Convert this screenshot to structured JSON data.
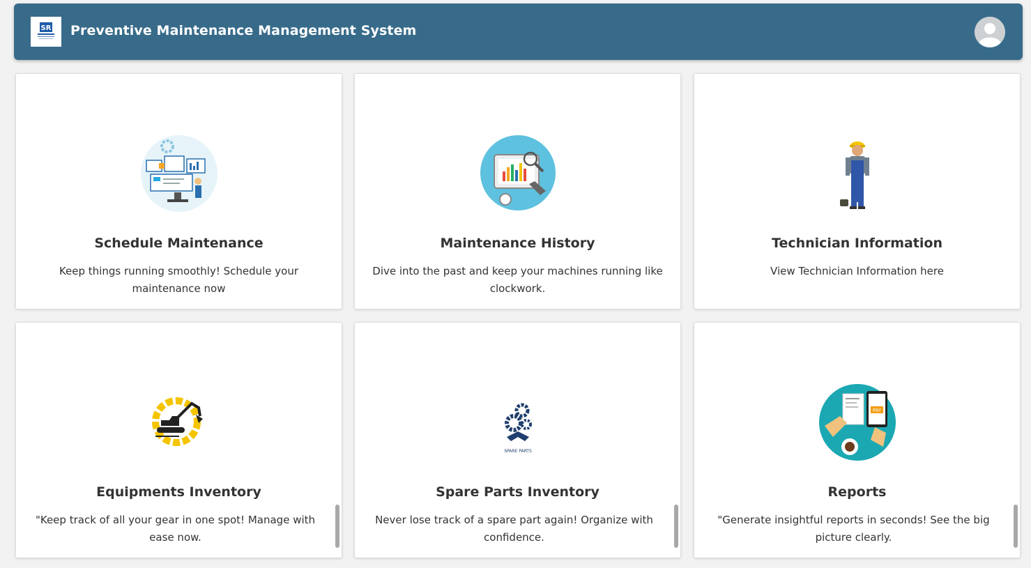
{
  "header": {
    "title": "Preventive Maintenance Management System",
    "logo_icon": "company-logo-icon",
    "avatar_icon": "user-avatar-icon"
  },
  "cards": [
    {
      "title": "Schedule Maintenance",
      "description": "Keep things running smoothly! Schedule your maintenance now",
      "icon": "schedule-maintenance-icon"
    },
    {
      "title": "Maintenance History",
      "description": "Dive into the past and keep your machines running like clockwork.",
      "icon": "maintenance-history-icon"
    },
    {
      "title": "Technician Information",
      "description": "View Technician Information here",
      "icon": "technician-icon"
    },
    {
      "title": "Equipments Inventory",
      "description": "\"Keep track of all your gear in one spot! Manage with ease now.",
      "icon": "excavator-gear-icon"
    },
    {
      "title": "Spare Parts Inventory",
      "description": "Never lose track of a spare part again! Organize with confidence.",
      "icon": "spare-parts-icon",
      "icon_caption": "SPARE PARTS"
    },
    {
      "title": "Reports",
      "description": "\"Generate insightful reports in seconds! See the big picture clearly.",
      "icon": "reports-icon",
      "icon_badge": "PAY"
    }
  ],
  "colors": {
    "header_bg": "#386b8a",
    "page_bg": "#f2f2f2",
    "card_bg": "#ffffff",
    "text": "#333333"
  }
}
